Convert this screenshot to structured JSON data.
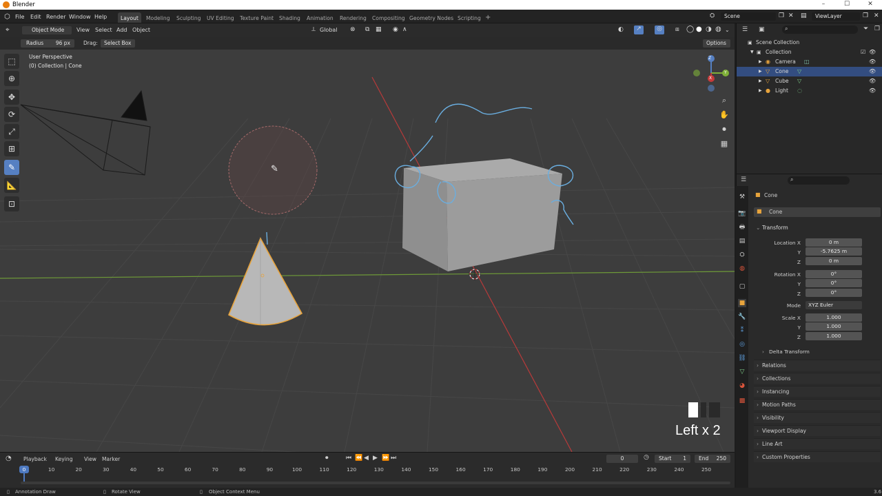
{
  "window": {
    "title": "Blender",
    "controls": [
      "–",
      "☐",
      "✕"
    ]
  },
  "menus": [
    "File",
    "Edit",
    "Render",
    "Window",
    "Help"
  ],
  "workspaces": [
    "Layout",
    "Modeling",
    "Sculpting",
    "UV Editing",
    "Texture Paint",
    "Shading",
    "Animation",
    "Rendering",
    "Compositing",
    "Geometry Nodes",
    "Scripting",
    "+"
  ],
  "scene": {
    "name": "Scene",
    "view_layer": "ViewLayer"
  },
  "viewport_header": {
    "mode": "Object Mode",
    "view": "View",
    "select": "Select",
    "add": "Add",
    "object": "Object",
    "orientation": "Global"
  },
  "tool_settings": {
    "radius_label": "Radius",
    "radius_value": "96 px",
    "drag_label": "Drag:",
    "drag_value": "Select Box",
    "options": "Options"
  },
  "viewport": {
    "perspective": "User Perspective",
    "collection": "(0) Collection | Cone",
    "keystroke": "Left x 2",
    "gizmo_axes": [
      "Z",
      "Y",
      "X"
    ]
  },
  "colors": {
    "accent": "#5680c2",
    "selection_outline": "#e8a43c",
    "annotation": "#6aaee0",
    "x_axis": "#c83a3a",
    "y_axis": "#7fb038"
  },
  "outliner": {
    "search_icon": "search-icon",
    "items": [
      {
        "label": "Scene Collection"
      },
      {
        "label": "Collection"
      },
      {
        "label": "Camera"
      },
      {
        "label": "Cone"
      },
      {
        "label": "Cube"
      },
      {
        "label": "Light"
      }
    ]
  },
  "properties": {
    "object_name": "Cone",
    "data_name": "Cone",
    "transform_label": "Transform",
    "location_label": "Location X",
    "location": [
      "0 m",
      "-5.7625 m",
      "0 m"
    ],
    "rotation_label": "Rotation X",
    "rotation": [
      "0°",
      "0°",
      "0°"
    ],
    "mode_label": "Mode",
    "mode_value": "XYZ Euler",
    "scale_label": "Scale X",
    "scale": [
      "1.000",
      "1.000",
      "1.000"
    ],
    "axis_y": "Y",
    "axis_z": "Z",
    "panels": [
      "Delta Transform",
      "Relations",
      "Collections",
      "Instancing",
      "Motion Paths",
      "Visibility",
      "Viewport Display",
      "Line Art",
      "Custom Properties"
    ]
  },
  "timeline": {
    "menus": [
      "Playback",
      "Keying",
      "View",
      "Marker"
    ],
    "current_frame": "0",
    "start_label": "Start",
    "start": "1",
    "end_label": "End",
    "end": "250",
    "ticks": [
      "0",
      "10",
      "20",
      "30",
      "40",
      "50",
      "60",
      "70",
      "80",
      "90",
      "100",
      "110",
      "120",
      "130",
      "140",
      "150",
      "160",
      "170",
      "180",
      "190",
      "200",
      "210",
      "220",
      "230",
      "240",
      "250"
    ],
    "cursor_frame": "0"
  },
  "status": {
    "left": "Annotation Draw",
    "middle": "Rotate View",
    "right": "Object Context Menu",
    "version": "3.6"
  }
}
